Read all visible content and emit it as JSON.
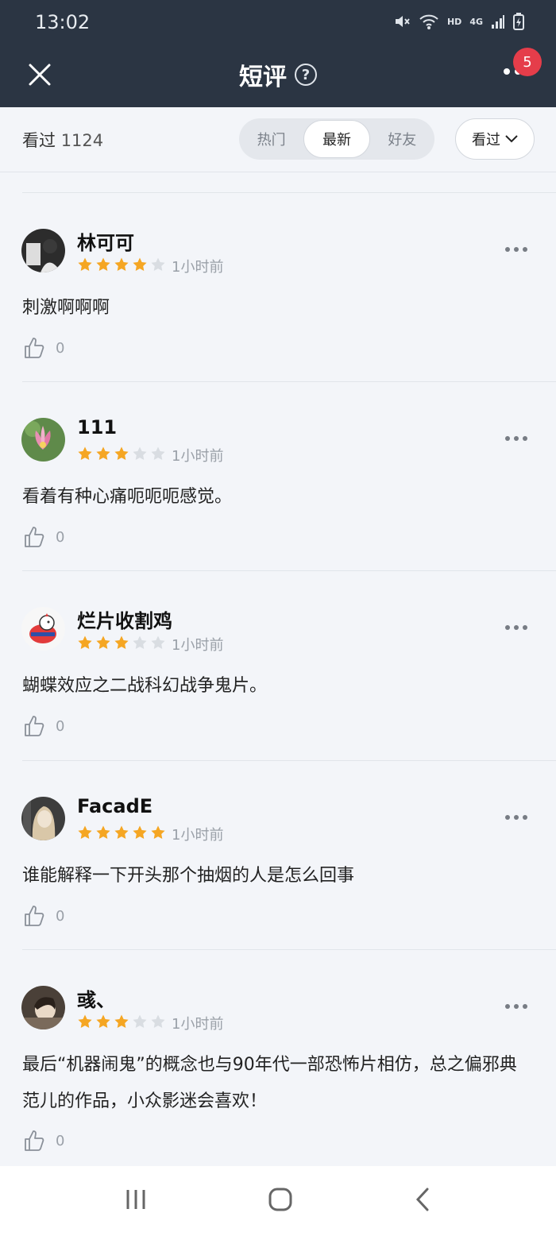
{
  "status_bar": {
    "time": "13:02",
    "icons": [
      "mute-icon",
      "wifi-icon",
      "hd-icon",
      "4g-icon",
      "signal-icon",
      "battery-icon"
    ],
    "hd_label": "HD",
    "net_label": "4G"
  },
  "header": {
    "title": "短评",
    "help_symbol": "?",
    "notification_count": "5"
  },
  "filter": {
    "watched_label": "看过",
    "watched_count": "1124",
    "tabs": [
      {
        "label": "热门",
        "active": false
      },
      {
        "label": "最新",
        "active": true
      },
      {
        "label": "好友",
        "active": false
      }
    ],
    "dropdown_label": "看过"
  },
  "reviews": [
    {
      "user": "林可可",
      "stars": 4,
      "time": "1小时前",
      "text": "刺激啊啊啊",
      "likes": "0"
    },
    {
      "user": "111",
      "stars": 3,
      "time": "1小时前",
      "text": "看着有种心痛呃呃呃感觉。",
      "likes": "0"
    },
    {
      "user": "烂片收割鸡",
      "stars": 3,
      "time": "1小时前",
      "text": "蝴蝶效应之二战科幻战争鬼片。",
      "likes": "0"
    },
    {
      "user": "FacadE",
      "stars": 5,
      "time": "1小时前",
      "text": "谁能解释一下开头那个抽烟的人是怎么回事",
      "likes": "0"
    },
    {
      "user": "彧、",
      "stars": 3,
      "time": "1小时前",
      "text": "最后“机器闹鬼”的概念也与90年代一部恐怖片相仿，总之偏邪典范儿的作品，小众影迷会喜欢！",
      "likes": "0"
    }
  ],
  "colors": {
    "header_bg": "#2b3543",
    "star_filled": "#f5a623",
    "star_empty": "#d9dde2",
    "badge": "#e53d4a"
  },
  "bottom_nav": [
    "recents-icon",
    "home-icon",
    "back-icon"
  ]
}
